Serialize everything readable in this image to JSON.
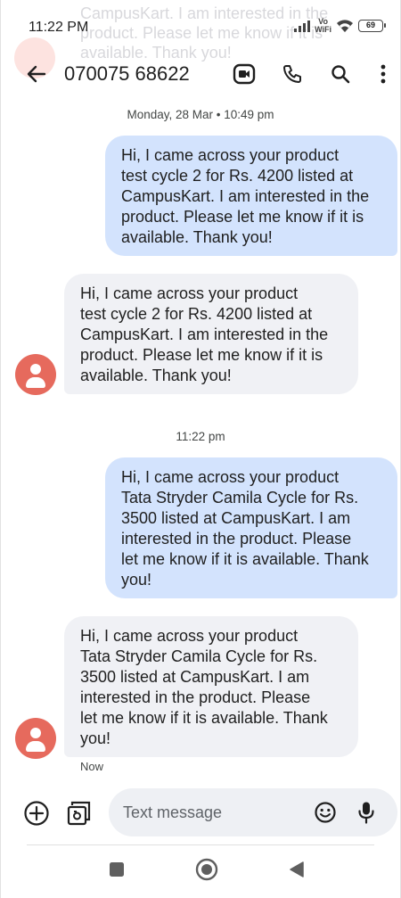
{
  "status_bar": {
    "time": "11:22 PM",
    "vowifi_line1": "Vo",
    "vowifi_line2": "WiFi",
    "battery": "69"
  },
  "notification_ghost": {
    "text": "CampusKart. I am interested in the product. Please let me know if it is available. Thank you!"
  },
  "header": {
    "contact": "070075 68622",
    "icons": [
      "back-arrow-icon",
      "video-call-icon",
      "phone-icon",
      "search-icon",
      "more-vert-icon"
    ]
  },
  "conversation": {
    "date_separator": "Monday, 28 Mar • 10:49 pm",
    "messages": [
      {
        "direction": "outgoing",
        "text": "Hi, I came across your product\ntest cycle 2 for Rs. 4200 listed at\nCampusKart. I am interested in the\nproduct. Please let me know if it is\navailable. Thank you!"
      },
      {
        "direction": "incoming",
        "text": "Hi, I came across your product\ntest cycle 2 for Rs. 4200 listed at\nCampusKart. I am interested in the\nproduct. Please let me know if it is\navailable. Thank you!"
      },
      {
        "direction": "outgoing",
        "text": "Hi, I came across your product\nTata Stryder Camila Cycle for Rs.\n3500 listed at CampusKart. I am\ninterested in the product. Please\nlet me know if it is available. Thank\nyou!"
      },
      {
        "direction": "incoming",
        "text": "Hi, I came across your product\nTata Stryder Camila Cycle for Rs.\n3500 listed at CampusKart. I am\ninterested in the product. Please\nlet me know if it is available. Thank\nyou!"
      }
    ],
    "time_separator": "11:22 pm",
    "last_status": "Now"
  },
  "composer": {
    "placeholder": "Text message",
    "icons": [
      "add-circle-icon",
      "gallery-icon",
      "emoji-icon",
      "mic-icon"
    ]
  },
  "nav_bar": {
    "icons": [
      "recents-square-icon",
      "home-circle-icon",
      "back-triangle-icon"
    ]
  },
  "colors": {
    "outgoing_bubble": "#d3e3fd",
    "incoming_bubble": "#f0f1f5",
    "avatar": "#e66a5d",
    "composer_bg": "#eef0f4"
  }
}
